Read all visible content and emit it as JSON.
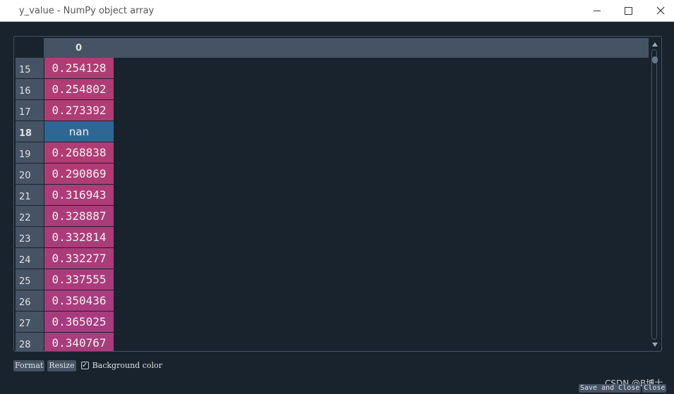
{
  "window": {
    "title": "y_value - NumPy object array"
  },
  "table": {
    "column_header": "0",
    "rows": [
      {
        "index": "15",
        "value": "0.254128",
        "color": "#b03c74"
      },
      {
        "index": "16",
        "value": "0.254802",
        "color": "#b03c74"
      },
      {
        "index": "17",
        "value": "0.273392",
        "color": "#b03c74"
      },
      {
        "index": "18",
        "value": "nan",
        "color": "#306694",
        "selected": true
      },
      {
        "index": "19",
        "value": "0.268838",
        "color": "#b03c74"
      },
      {
        "index": "20",
        "value": "0.290869",
        "color": "#b03c76"
      },
      {
        "index": "21",
        "value": "0.316943",
        "color": "#ad3c78"
      },
      {
        "index": "22",
        "value": "0.328887",
        "color": "#ab3c7a"
      },
      {
        "index": "23",
        "value": "0.332814",
        "color": "#ab3c7a"
      },
      {
        "index": "24",
        "value": "0.332277",
        "color": "#ab3c7a"
      },
      {
        "index": "25",
        "value": "0.337555",
        "color": "#aa3c7b"
      },
      {
        "index": "26",
        "value": "0.350436",
        "color": "#a83c7d"
      },
      {
        "index": "27",
        "value": "0.365025",
        "color": "#a63c7f"
      },
      {
        "index": "28",
        "value": "0.340767",
        "color": "#a93c7c"
      }
    ]
  },
  "toolbar": {
    "format_label": "Format",
    "resize_label": "Resize",
    "background_color_label": "Background color",
    "background_color_checked": true
  },
  "footer": {
    "watermark": "CSDN @B博士",
    "save_close_label": "Save and Close",
    "close_label": "Close"
  },
  "icons": {
    "minimize": "minimize-icon",
    "maximize": "maximize-icon",
    "close": "close-icon"
  }
}
